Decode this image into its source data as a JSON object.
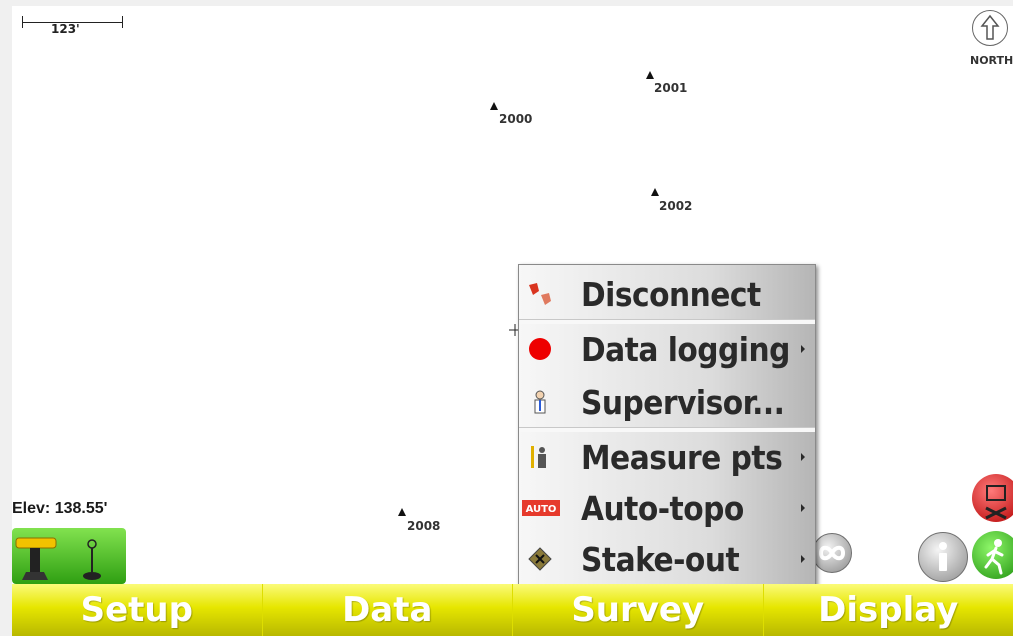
{
  "map": {
    "scale_label": "123'",
    "north_label": "NORTH",
    "elevation_label": "Elev: 138.55'",
    "points": [
      {
        "id": "2000",
        "label": "2000"
      },
      {
        "id": "2001",
        "label": "2001"
      },
      {
        "id": "2002",
        "label": "2002"
      },
      {
        "id": "2008",
        "label": "2008"
      }
    ]
  },
  "context_menu": {
    "items": [
      {
        "label": "Disconnect",
        "icon": "disconnect-icon",
        "has_submenu": false
      },
      {
        "label": "Data logging",
        "icon": "red-dot-icon",
        "has_submenu": true
      },
      {
        "label": "Supervisor...",
        "icon": "supervisor-icon",
        "has_submenu": false
      },
      {
        "label": "Measure pts",
        "icon": "rodman-icon",
        "has_submenu": true
      },
      {
        "label": "Auto-topo",
        "icon": "auto-icon",
        "auto_badge": "AUTO",
        "has_submenu": true
      },
      {
        "label": "Stake-out",
        "icon": "stakeout-icon",
        "has_submenu": true
      }
    ]
  },
  "bottom_bar": {
    "tabs": [
      "Setup",
      "Data",
      "Survey",
      "Display"
    ]
  },
  "colors": {
    "tab_yellow": "#e6e600",
    "menu_gray": "#dcdcdc",
    "green_button": "#2f9f12",
    "red_button": "#b30000"
  }
}
